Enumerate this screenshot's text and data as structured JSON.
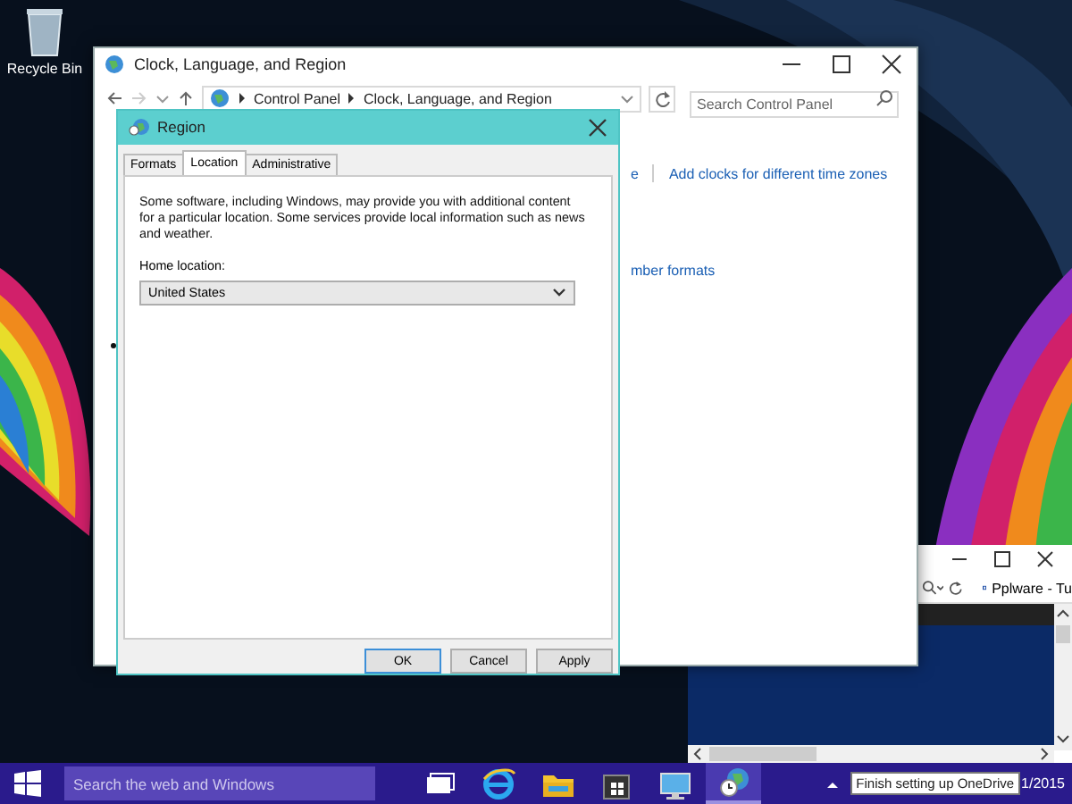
{
  "desktop": {
    "icons": [
      {
        "label": "Recycle Bin"
      }
    ]
  },
  "control_panel_window": {
    "title": "Clock, Language, and Region",
    "breadcrumb": [
      "Control Panel",
      "Clock, Language, and Region"
    ],
    "search": {
      "placeholder": "Search Control Panel"
    },
    "link_groups": [
      {
        "links": [
          {
            "text": "e"
          },
          {
            "text": "Add clocks for different time zones"
          }
        ]
      },
      {
        "links": [
          {
            "text": "mber formats"
          }
        ]
      }
    ]
  },
  "region_dialog": {
    "title": "Region",
    "tabs": [
      {
        "label": "Formats",
        "selected": false
      },
      {
        "label": "Location",
        "selected": true
      },
      {
        "label": "Administrative",
        "selected": false
      }
    ],
    "description": "Some software, including Windows, may provide you with additional content for a particular location. Some services provide local information such as news and weather.",
    "home_location_label": "Home location:",
    "home_location": {
      "value": "United States"
    },
    "buttons": [
      {
        "label": "OK",
        "default": true
      },
      {
        "label": "Cancel",
        "default": false
      },
      {
        "label": "Apply",
        "default": false
      }
    ]
  },
  "browser_window": {
    "tab_title": "Pplware - Tu"
  },
  "taskbar": {
    "search": {
      "placeholder": "Search the web and Windows"
    },
    "apps": [
      {
        "kind": "task-view",
        "active": false
      },
      {
        "kind": "browser",
        "active": false
      },
      {
        "kind": "folder",
        "active": false
      },
      {
        "kind": "store",
        "active": false
      },
      {
        "kind": "remote-desktop",
        "active": false
      },
      {
        "kind": "control-panel",
        "active": true
      }
    ],
    "tooltip": "Finish setting up OneDrive",
    "clock": "1/2015"
  }
}
